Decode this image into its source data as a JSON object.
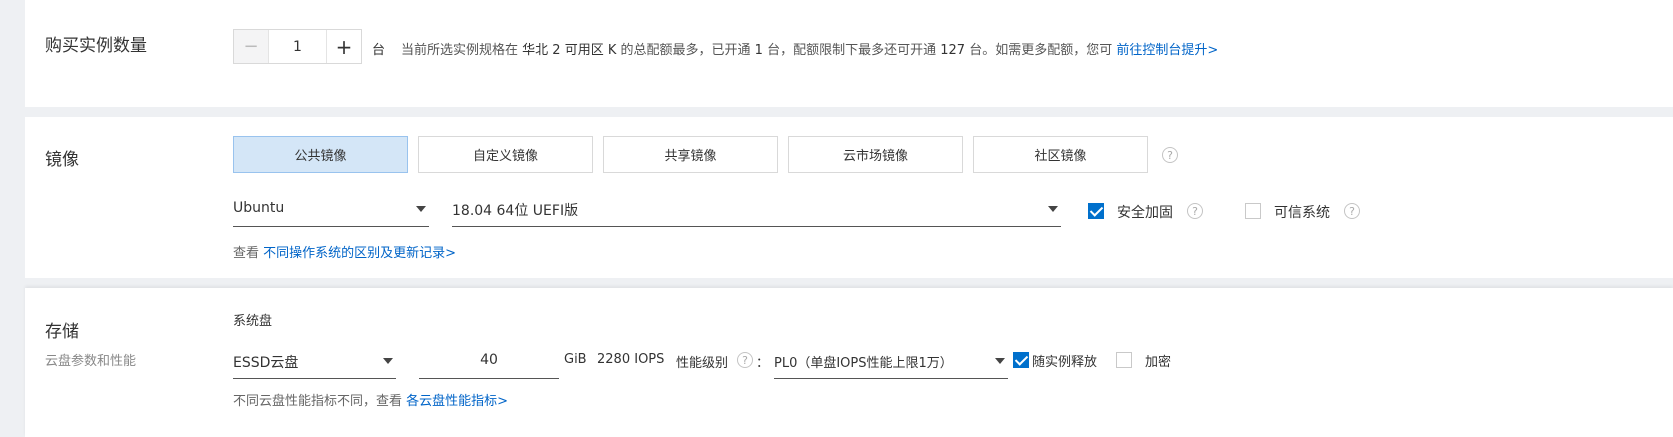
{
  "quantity": {
    "title": "购买实例数量",
    "minus_symbol": "−",
    "value": "1",
    "plus_symbol": "+",
    "unit": "台",
    "hint_prefix": "当前所选实例规格在",
    "hint_zone": "华北 2 可用区 K",
    "hint_mid1": "的总配额最多，已开通",
    "hint_opened": "1",
    "hint_mid2": "台，配额限制下最多还可开通",
    "hint_remaining": "127",
    "hint_suffix": "台。如需更多配额，您可",
    "hint_link": "前往控制台提升>"
  },
  "image": {
    "title": "镜像",
    "tabs": [
      {
        "label": "公共镜像",
        "active": true
      },
      {
        "label": "自定义镜像",
        "active": false
      },
      {
        "label": "共享镜像",
        "active": false
      },
      {
        "label": "云市场镜像",
        "active": false
      },
      {
        "label": "社区镜像",
        "active": false
      }
    ],
    "help_symbol": "?",
    "os_select": "Ubuntu",
    "version_select": "18.04 64位 UEFI版",
    "security_label": "安全加固",
    "security_checked": true,
    "trusted_label": "可信系统",
    "trusted_checked": false,
    "note_prefix": "查看",
    "note_link": "不同操作系统的区别及更新记录>"
  },
  "storage": {
    "title": "存储",
    "subtitle": "云盘参数和性能",
    "system_disk_label": "系统盘",
    "disk_type": "ESSD云盘",
    "disk_size": "40",
    "size_unit": "GiB",
    "iops_value": "2280",
    "iops_unit": "IOPS",
    "perf_label": "性能级别",
    "perf_colon": "：",
    "perf_level": "PL0（单盘IOPS性能上限1万）",
    "release_label": "随实例释放",
    "release_checked": true,
    "encrypt_label": "加密",
    "encrypt_checked": false,
    "note_prefix": "不同云盘性能指标不同，查看",
    "note_link": "各云盘性能指标>"
  },
  "colors": {
    "accent": "#0070cc",
    "link": "#0064c8",
    "active_tab_bg": "#d4e6f7",
    "page_bg": "#eef0f3"
  }
}
